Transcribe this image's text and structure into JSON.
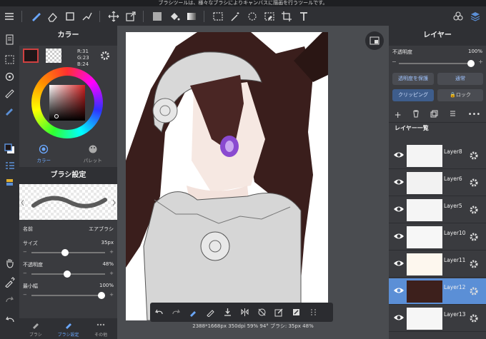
{
  "status_bar": {
    "message": "ブラシツールは、様々なブラシによりキャンバスに描画を行うツールです。"
  },
  "color_panel": {
    "title": "カラー",
    "rgb": {
      "r": "R:31",
      "g": "G:23",
      "b": "B:24"
    },
    "primary_color": "#1f1718",
    "tabs": [
      {
        "label": "カラー"
      },
      {
        "label": "パレット"
      }
    ]
  },
  "brush_panel": {
    "title": "ブラシ設定",
    "name_label": "名前",
    "name_value": "エアブラシ",
    "size_label": "サイズ",
    "size_value": "35px",
    "size_fraction": 0.45,
    "opacity_label": "不透明度",
    "opacity_value": "48%",
    "opacity_fraction": 0.48,
    "min_width_label": "最小幅",
    "min_width_value": "100%",
    "min_width_fraction": 1.0,
    "bottom_tabs": [
      {
        "label": "ブラシ"
      },
      {
        "label": "ブラシ設定"
      },
      {
        "label": "その他"
      }
    ]
  },
  "canvas_info": {
    "text": "2388*1668px 350dpi 59% 94° ブラシ: 35px 48%"
  },
  "layer_panel": {
    "title": "レイヤー",
    "opacity_label": "不透明度",
    "opacity_value": "100%",
    "protect_label": "透明度を保護",
    "blend_label": "通常",
    "clipping_label": "クリッピング",
    "lock_label": "ロック",
    "list_title": "レイヤー一覧",
    "layers": [
      {
        "name": "Layer8"
      },
      {
        "name": "Layer6"
      },
      {
        "name": "Layer5"
      },
      {
        "name": "Layer10"
      },
      {
        "name": "Layer11"
      },
      {
        "name": "Layer12",
        "selected": true
      },
      {
        "name": "Layer13"
      }
    ]
  },
  "accent_color": "#5b8fd6"
}
